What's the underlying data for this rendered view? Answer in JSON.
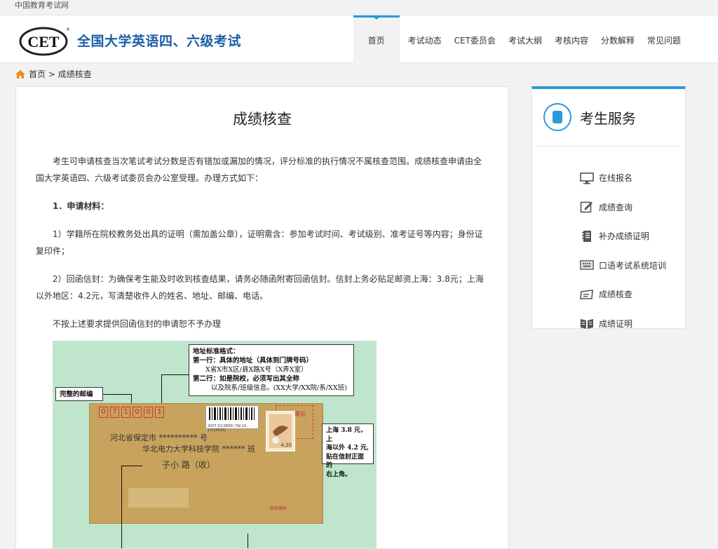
{
  "topbar": {
    "text": "中国教育考试网"
  },
  "header": {
    "logo_text": "CET",
    "site_title": "全国大学英语四、六级考试",
    "nav": [
      {
        "label": "首页",
        "active": true
      },
      {
        "label": "考试动态"
      },
      {
        "label": "CET委员会"
      },
      {
        "label": "考试大纲"
      },
      {
        "label": "考核内容"
      },
      {
        "label": "分数解释"
      },
      {
        "label": "常见问题"
      }
    ]
  },
  "breadcrumb": {
    "home": "首页",
    "separator": " > ",
    "current": "成绩核查"
  },
  "article": {
    "title": "成绩核查",
    "p1": "考生可申请核查当次笔试考试分数是否有错加或漏加的情况，评分标准的执行情况不属核查范围。成绩核查申请由全国大学英语四、六级考试委员会办公室受理。办理方式如下：",
    "p2": "1．申请材料：",
    "p3": "1）学籍所在院校教务处出具的证明（需加盖公章），证明需含：参加考试时间、考试级别、准考证号等内容；身份证复印件；",
    "p4": "2）回函信封：为确保考生能及时收到核查结果，请务必随函附寄回函信封。信封上务必贴足邮资上海：3.8元；上海以外地区：4.2元，写清楚收件人的姓名、地址、邮编、电话。",
    "p5": "不按上述要求提供回函信封的申请恕不予办理"
  },
  "figure": {
    "addr_box": [
      "地址标准格式：",
      "第一行：具体的地址（具体到门牌号码）",
      "X省X市X区/县X路X号（X弄X室）",
      "第二行：如是院校，必须写出其全称",
      "以及院系/班级信息。(XX大学/XX院/系/XX班)"
    ],
    "zip_label": "完整的邮编",
    "zip_digits": [
      "0",
      "7",
      "1",
      "0",
      "0",
      "1"
    ],
    "stamp_box": "贴邮票处",
    "postage_box": [
      "上海 3.8 元，上",
      "海以外 4.2 元,",
      "贴在信封正面的",
      "右上角。"
    ],
    "hand_addr1": "河北省保定市 ********** 号",
    "hand_addr2": "华北电力大学科技学院 ****** 班",
    "hand_name": "子小 路（收）",
    "barcode_text": "2007 01(2800) 7W-10-17(10033)",
    "stamp_value": "4.20",
    "postcode_field": "邮政编码"
  },
  "sidebar": {
    "title": "考生服务",
    "items": [
      {
        "label": "在线报名",
        "icon": "monitor-icon"
      },
      {
        "label": "成绩查询",
        "icon": "edit-icon"
      },
      {
        "label": "补办成绩证明",
        "icon": "notebook-icon"
      },
      {
        "label": "口语考试系统培训",
        "icon": "keyboard-icon"
      },
      {
        "label": "成绩核查",
        "icon": "certificate-icon"
      },
      {
        "label": "成绩证明",
        "icon": "book-icon"
      }
    ]
  }
}
